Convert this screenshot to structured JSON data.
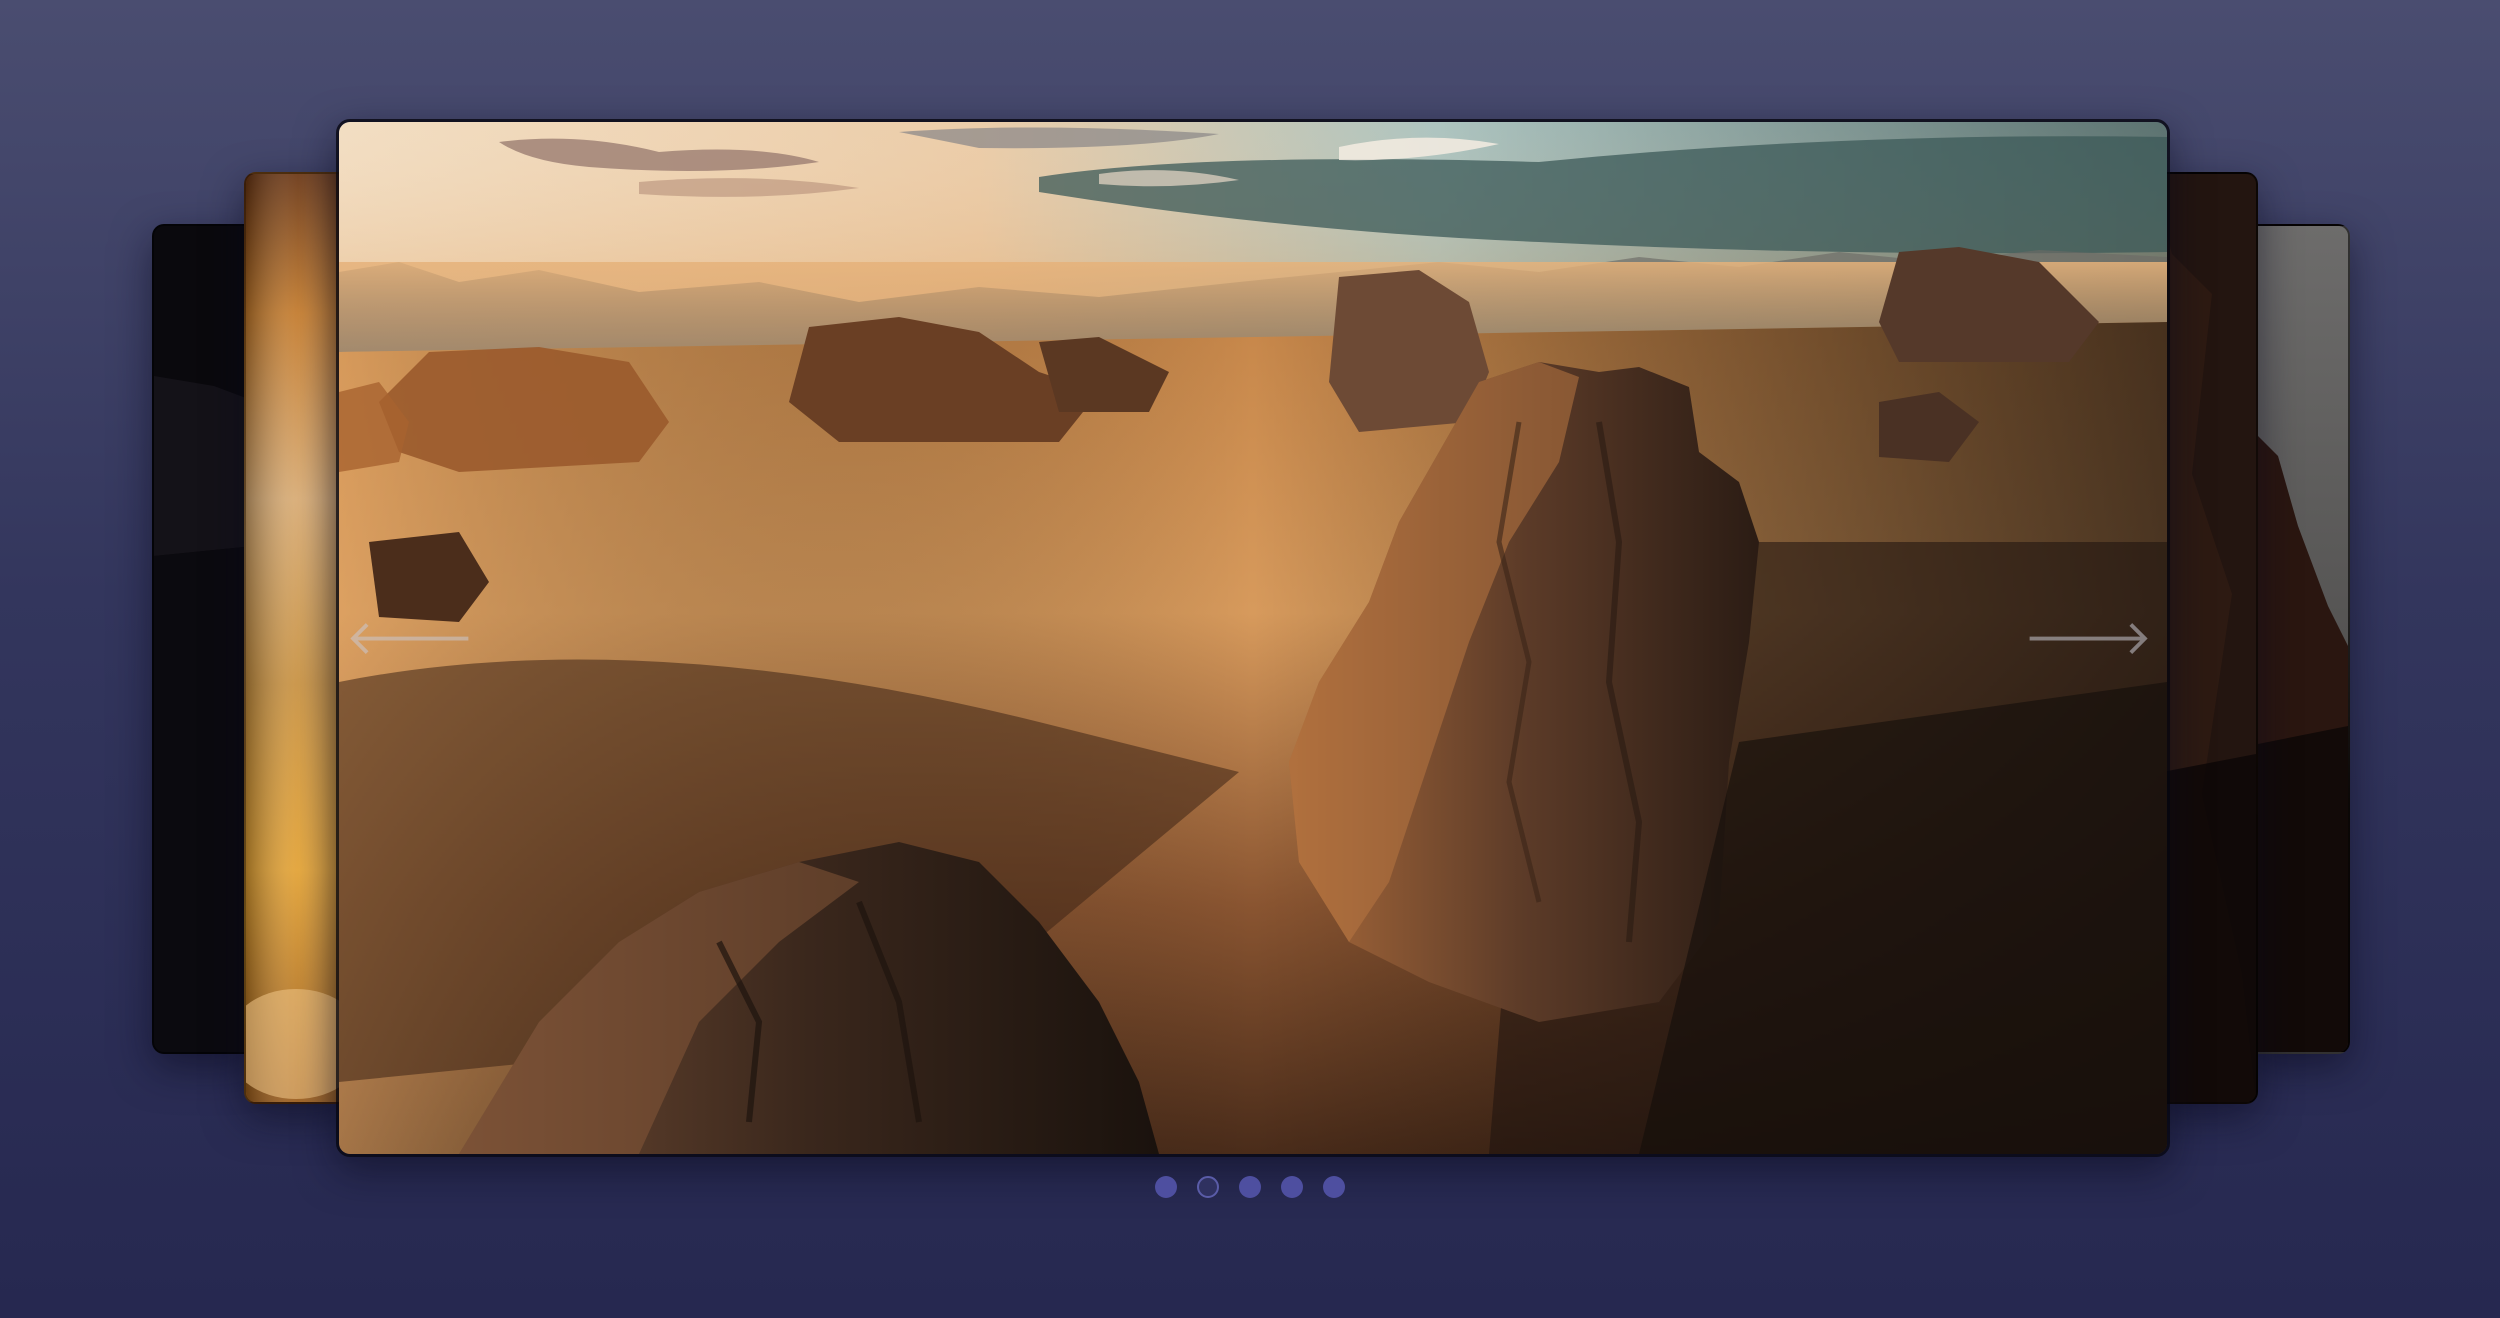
{
  "carousel": {
    "slides": [
      {
        "icon": "dark-landscape-image",
        "position": "back-left-2"
      },
      {
        "icon": "sunset-clouds-image",
        "position": "back-left-1"
      },
      {
        "icon": "desert-rock-formations-image",
        "position": "main"
      },
      {
        "icon": "dark-cliff-image",
        "position": "back-right-1"
      },
      {
        "icon": "grey-sky-cliff-image",
        "position": "back-right-2"
      }
    ],
    "active_index": 1,
    "slide_count": 5,
    "prev_icon": "arrow-left-icon",
    "next_icon": "arrow-right-icon",
    "prev_glyph": "🡐",
    "next_glyph": "🡒"
  },
  "colors": {
    "background_top": "#4a4d70",
    "background_bottom": "#262850",
    "dot": "#4e4fa0",
    "dot_active": "#2f3160"
  }
}
